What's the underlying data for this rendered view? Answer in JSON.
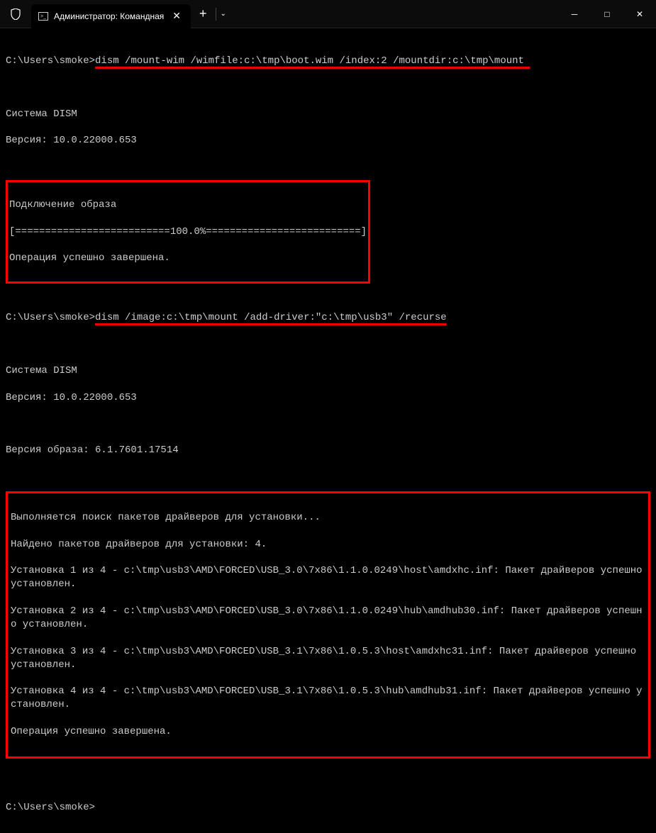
{
  "window": {
    "tab_title": "Администратор: Командная",
    "new_tab": "+",
    "dropdown": "⌄",
    "minimize": "─",
    "maximize": "□",
    "close": "✕",
    "tab_close": "✕"
  },
  "term": {
    "prompt": "C:\\Users\\smoke>",
    "cmd1": "dism /mount-wim /wimfile:c:\\tmp\\boot.wim /index:2 /mountdir:c:\\tmp\\mount ",
    "block1": {
      "l1": "Cистема DISM",
      "l2": "Версия: 10.0.22000.653"
    },
    "box1": {
      "l1": "Подключение образа",
      "l2": "[==========================100.0%==========================]",
      "l3": "Операция успешно завершена."
    },
    "cmd2": "dism /image:c:\\tmp\\mount /add-driver:\"c:\\tmp\\usb3\" /recurse",
    "block2": {
      "l1": "Cистема DISM",
      "l2": "Версия: 10.0.22000.653"
    },
    "imgver": "Версия образа: 6.1.7601.17514",
    "box2": {
      "l1": "Выполняется поиск пакетов драйверов для установки...",
      "l2": "Найдено пакетов драйверов для установки: 4.",
      "l3": "Установка 1 из 4 - c:\\tmp\\usb3\\AMD\\FORCED\\USB_3.0\\7x86\\1.1.0.0249\\host\\amdxhc.inf: Пакет драйверов успешно установлен.",
      "l4": "Установка 2 из 4 - c:\\tmp\\usb3\\AMD\\FORCED\\USB_3.0\\7x86\\1.1.0.0249\\hub\\amdhub30.inf: Пакет драйверов успешно установлен.",
      "l5": "Установка 3 из 4 - c:\\tmp\\usb3\\AMD\\FORCED\\USB_3.1\\7x86\\1.0.5.3\\host\\amdxhc31.inf: Пакет драйверов успешно установлен.",
      "l6": "Установка 4 из 4 - c:\\tmp\\usb3\\AMD\\FORCED\\USB_3.1\\7x86\\1.0.5.3\\hub\\amdhub31.inf: Пакет драйверов успешно установлен.",
      "l7": "Операция успешно завершена."
    }
  }
}
